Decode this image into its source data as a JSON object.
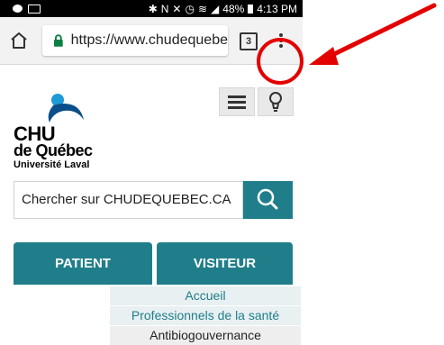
{
  "statusbar": {
    "battery": "48%",
    "time": "4:13 PM"
  },
  "browser": {
    "url": "https://www.chudequebe",
    "tab_count": "3"
  },
  "site": {
    "logo_line1": "CHU",
    "logo_line2": "de Québec",
    "logo_line3": "Université Laval",
    "search_placeholder": "Chercher sur CHUDEQUEBEC.CA",
    "tabs": [
      {
        "label": "PATIENT"
      },
      {
        "label": "VISITEUR"
      }
    ],
    "links": [
      {
        "label": "Accueil"
      },
      {
        "label": "Professionnels de la santé"
      },
      {
        "label": "Antibiogouvernance"
      }
    ]
  },
  "colors": {
    "teal": "#1f7e8a",
    "annotation_red": "#e30000"
  },
  "icons": {
    "home": "home-icon",
    "lock": "lock-icon",
    "menu": "overflow-menu-icon",
    "hamburger": "hamburger-icon",
    "bulb": "lightbulb-icon",
    "search": "search-icon"
  }
}
